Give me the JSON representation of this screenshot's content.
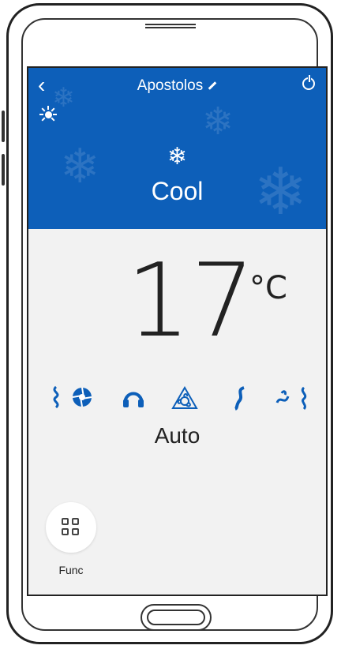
{
  "header": {
    "title": "Apostolos",
    "mode_icon": "❄",
    "mode_label": "Cool"
  },
  "temperature": {
    "value": "17",
    "unit": "°C"
  },
  "fan": {
    "current_label": "Auto",
    "icons": [
      "fan-speed-1-icon",
      "fan-speed-2-icon",
      "quiet-fan-icon",
      "auto-fan-icon",
      "swing-vertical-icon",
      "swing-horizontal-icon"
    ]
  },
  "bottom": {
    "func_label": "Func"
  },
  "colors": {
    "header_bg": "#0d5fb9",
    "screen_bg": "#f2f2f2",
    "accent": "#0d5fb9"
  }
}
